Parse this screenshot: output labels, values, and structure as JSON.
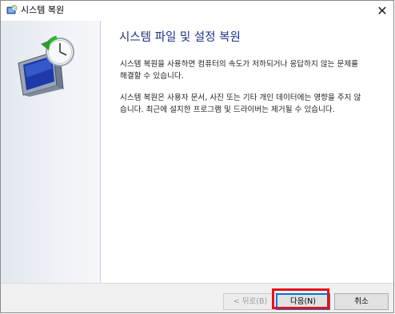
{
  "window": {
    "title": "시스템 복원",
    "close_symbol": "✕"
  },
  "content": {
    "heading": "시스템 파일 및 설정 복원",
    "paragraph1": "시스템 복원을 사용하면 컴퓨터의 속도가 저하되거나 응답하지 않는 문제를 해결할 수 있습니다.",
    "paragraph2": "시스템 복원은 사용자 문서, 사진 또는 기타 개인 데이터에는 영향을 주지 않습니다. 최근에 설치한 프로그램 및 드라이버는 제거될 수 있습니다."
  },
  "buttons": {
    "back": "< 뒤로(B)",
    "next": "다음(N)",
    "cancel": "취소"
  },
  "icons": {
    "window_icon": "system-restore-icon",
    "side_graphic": "restore-computer-clock-icon"
  },
  "colors": {
    "heading": "#1e3287",
    "highlight": "#e8101b",
    "focus": "#0078d7"
  }
}
